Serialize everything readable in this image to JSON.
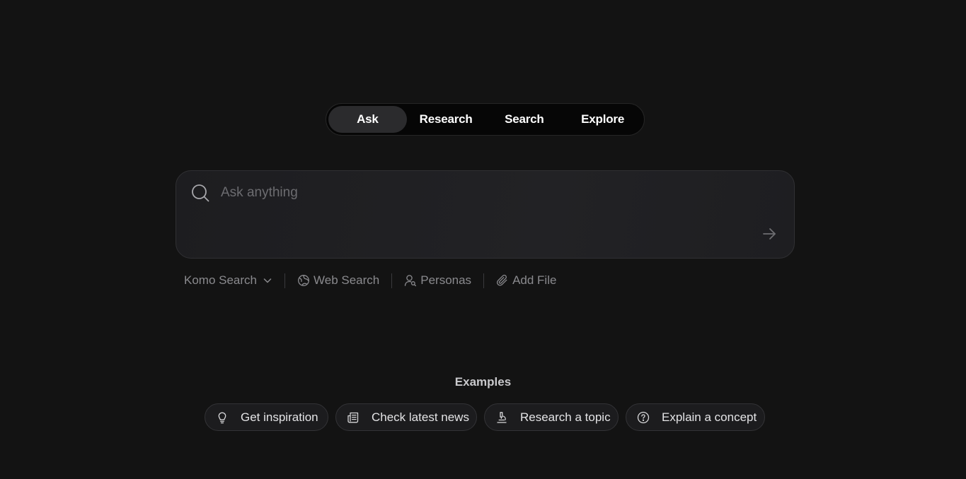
{
  "modes": {
    "tabs": [
      {
        "label": "Ask"
      },
      {
        "label": "Research"
      },
      {
        "label": "Search"
      },
      {
        "label": "Explore"
      }
    ],
    "active": "Ask"
  },
  "search": {
    "placeholder": "Ask anything",
    "value": "",
    "icon": "search-icon",
    "submit_icon": "arrow-right-icon"
  },
  "toolbar": {
    "model": {
      "label": "Komo Search",
      "icon": "chevron-down-icon"
    },
    "web_search": {
      "label": "Web Search",
      "icon": "globe-icon"
    },
    "personas": {
      "label": "Personas",
      "icon": "user-search-icon"
    },
    "add_file": {
      "label": "Add File",
      "icon": "paperclip-icon"
    }
  },
  "examples": {
    "title": "Examples",
    "items": [
      {
        "label": "Get inspiration",
        "icon": "lightbulb-icon"
      },
      {
        "label": "Check latest news",
        "icon": "newspaper-icon"
      },
      {
        "label": "Research a topic",
        "icon": "microscope-icon"
      },
      {
        "label": "Explain a concept",
        "icon": "question-circle-icon"
      }
    ]
  },
  "colors": {
    "background": "#131313",
    "tab_bar": "#060606",
    "active_tab": "#2b2b2d",
    "search_box": "#1f1f22",
    "muted_text": "#8a8a8e"
  }
}
